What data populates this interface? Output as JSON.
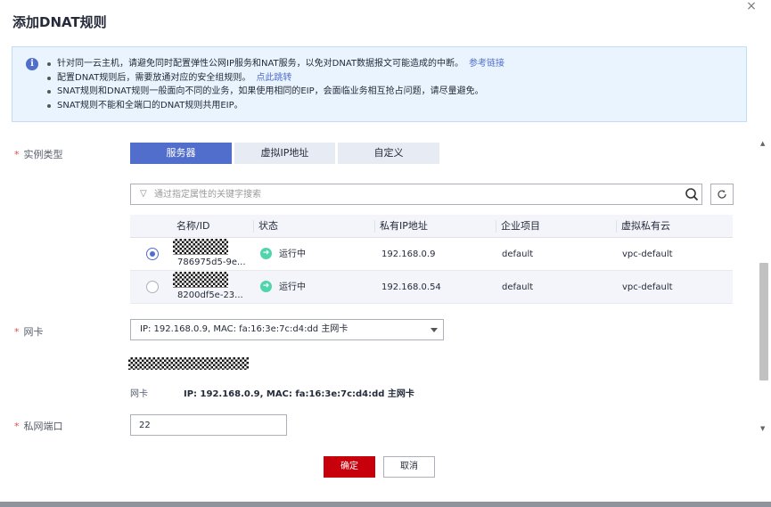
{
  "dialog": {
    "title": "添加DNAT规则",
    "close_glyph": "×"
  },
  "alert": {
    "icon": "info-icon",
    "icon_glyph": "i",
    "items": [
      {
        "text": "针对同一云主机，请避免同时配置弹性公网IP服务和NAT服务，以免对DNAT数据报文可能造成的中断。",
        "link": "参考链接"
      },
      {
        "text": "配置DNAT规则后，需要放通对应的安全组规则。",
        "link": "点此跳转"
      },
      {
        "text": "SNAT规则和DNAT规则一般面向不同的业务，如果使用相同的EIP，会面临业务相互抢占问题，请尽量避免。",
        "link": ""
      },
      {
        "text": "SNAT规则不能和全端口的DNAT规则共用EIP。",
        "link": ""
      }
    ]
  },
  "form": {
    "instance_type": {
      "label": "实例类型",
      "required_mark": "*",
      "options": [
        "服务器",
        "虚拟IP地址",
        "自定义"
      ],
      "selected": "服务器"
    },
    "search": {
      "placeholder": "通过指定属性的关键字搜索",
      "value": ""
    },
    "table": {
      "columns": [
        "名称/ID",
        "状态",
        "私有IP地址",
        "企业项目",
        "虚拟私有云"
      ],
      "rows": [
        {
          "selected": true,
          "id": "786975d5-9e...",
          "status": "运行中",
          "private_ip": "192.168.0.9",
          "enterprise_project": "default",
          "vpc": "vpc-default"
        },
        {
          "selected": false,
          "id": "8200df5e-23...",
          "status": "运行中",
          "private_ip": "192.168.0.54",
          "enterprise_project": "default",
          "vpc": "vpc-default"
        }
      ]
    },
    "nic": {
      "label": "网卡",
      "required_mark": "*",
      "value": "IP: 192.168.0.9, MAC: fa:16:3e:7c:d4:dd 主网卡",
      "detail_label": "网卡",
      "detail_value": "IP: 192.168.0.9, MAC: fa:16:3e:7c:d4:dd 主网卡"
    },
    "private_port": {
      "label": "私网端口",
      "required_mark": "*",
      "value": "22"
    }
  },
  "footer": {
    "confirm": "确定",
    "cancel": "取消"
  },
  "colors": {
    "accent": "#526ecc",
    "primary_button": "#c7000b",
    "status_running": "#50d4ab",
    "required": "#e84d4d"
  }
}
